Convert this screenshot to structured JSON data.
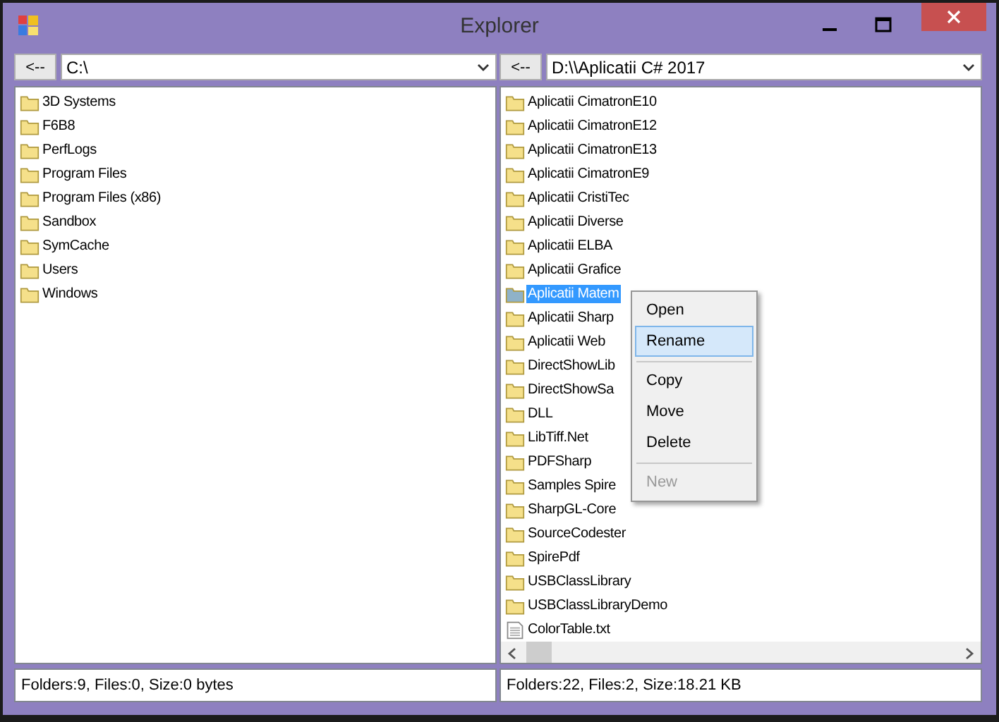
{
  "window": {
    "title": "Explorer"
  },
  "panes": [
    {
      "back_button": "<--",
      "path": "C:\\",
      "items": [
        {
          "kind": "folder",
          "name": "3D Systems",
          "selected": false
        },
        {
          "kind": "folder",
          "name": "F6B8",
          "selected": false
        },
        {
          "kind": "folder",
          "name": "PerfLogs",
          "selected": false
        },
        {
          "kind": "folder",
          "name": "Program Files",
          "selected": false
        },
        {
          "kind": "folder",
          "name": "Program Files (x86)",
          "selected": false
        },
        {
          "kind": "folder",
          "name": "Sandbox",
          "selected": false
        },
        {
          "kind": "folder",
          "name": "SymCache",
          "selected": false
        },
        {
          "kind": "folder",
          "name": "Users",
          "selected": false
        },
        {
          "kind": "folder",
          "name": "Windows",
          "selected": false
        }
      ],
      "status": "Folders:9, Files:0, Size:0 bytes"
    },
    {
      "back_button": "<--",
      "path": "D:\\\\Aplicatii C# 2017",
      "items": [
        {
          "kind": "folder",
          "name": "Aplicatii CimatronE10",
          "selected": false
        },
        {
          "kind": "folder",
          "name": "Aplicatii CimatronE12",
          "selected": false
        },
        {
          "kind": "folder",
          "name": "Aplicatii CimatronE13",
          "selected": false
        },
        {
          "kind": "folder",
          "name": "Aplicatii CimatronE9",
          "selected": false
        },
        {
          "kind": "folder",
          "name": "Aplicatii CristiTec",
          "selected": false
        },
        {
          "kind": "folder",
          "name": "Aplicatii Diverse",
          "selected": false
        },
        {
          "kind": "folder",
          "name": "Aplicatii ELBA",
          "selected": false
        },
        {
          "kind": "folder",
          "name": "Aplicatii Grafice",
          "selected": false
        },
        {
          "kind": "folder",
          "name": "Aplicatii Matem",
          "selected": true
        },
        {
          "kind": "folder",
          "name": "Aplicatii Sharp",
          "selected": false
        },
        {
          "kind": "folder",
          "name": "Aplicatii Web",
          "selected": false
        },
        {
          "kind": "folder",
          "name": "DirectShowLib",
          "selected": false
        },
        {
          "kind": "folder",
          "name": "DirectShowSa",
          "selected": false
        },
        {
          "kind": "folder",
          "name": "DLL",
          "selected": false
        },
        {
          "kind": "folder",
          "name": "LibTiff.Net",
          "selected": false
        },
        {
          "kind": "folder",
          "name": "PDFSharp",
          "selected": false
        },
        {
          "kind": "folder",
          "name": "Samples Spire",
          "selected": false
        },
        {
          "kind": "folder",
          "name": "SharpGL-Core",
          "selected": false
        },
        {
          "kind": "folder",
          "name": "SourceCodester",
          "selected": false
        },
        {
          "kind": "folder",
          "name": "SpirePdf",
          "selected": false
        },
        {
          "kind": "folder",
          "name": "USBClassLibrary",
          "selected": false
        },
        {
          "kind": "folder",
          "name": "USBClassLibraryDemo",
          "selected": false
        },
        {
          "kind": "file",
          "name": "ColorTable.txt",
          "selected": false
        }
      ],
      "status": "Folders:22, Files:2, Size:18.21 KB"
    }
  ],
  "context_menu": [
    {
      "kind": "item",
      "label": "Open",
      "selected": false,
      "disabled": false
    },
    {
      "kind": "item",
      "label": "Rename",
      "selected": true,
      "disabled": false
    },
    {
      "kind": "separator"
    },
    {
      "kind": "item",
      "label": "Copy",
      "selected": false,
      "disabled": false
    },
    {
      "kind": "item",
      "label": "Move",
      "selected": false,
      "disabled": false
    },
    {
      "kind": "item",
      "label": "Delete",
      "selected": false,
      "disabled": false
    },
    {
      "kind": "separator"
    },
    {
      "kind": "item",
      "label": "New",
      "selected": false,
      "disabled": true
    }
  ]
}
